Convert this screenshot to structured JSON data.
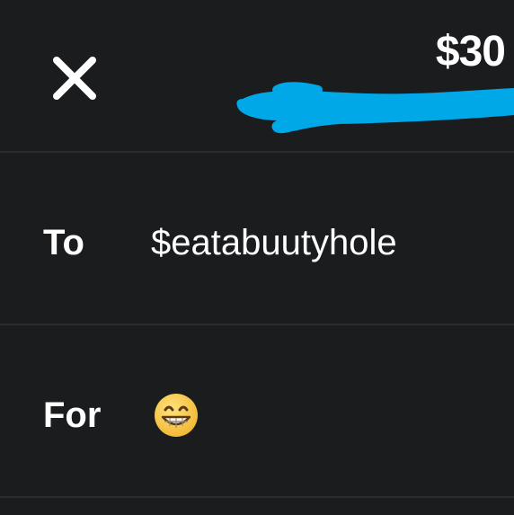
{
  "header": {
    "close_icon": "close-icon",
    "amount": "$30"
  },
  "to_row": {
    "label": "To",
    "recipient": "$eatabuutyhole"
  },
  "for_row": {
    "label": "For",
    "emoji_icon": "grinning-face-with-smiling-eyes-icon"
  },
  "colors": {
    "background": "#1b1c1e",
    "divider": "#2b2c2f",
    "text": "#ffffff",
    "redaction_scribble": "#00a8e8",
    "emoji_face": "#f6c945"
  }
}
